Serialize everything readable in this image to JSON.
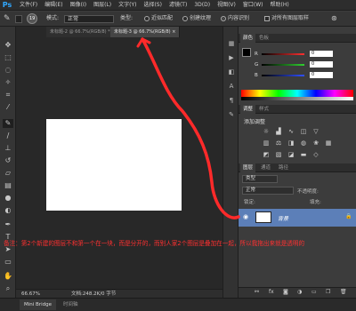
{
  "app": {
    "logo": "Ps"
  },
  "menu": [
    "文件(F)",
    "编辑(E)",
    "图像(I)",
    "图层(L)",
    "文字(Y)",
    "选择(S)",
    "滤镜(T)",
    "3D(D)",
    "视图(V)",
    "窗口(W)",
    "帮助(H)"
  ],
  "options": {
    "size_value": "19",
    "mode_label": "模式:",
    "mode_value": "正常",
    "type_label": "类型:",
    "type_options": [
      {
        "label": "近似匹配",
        "selected": false
      },
      {
        "label": "创建纹理",
        "selected": false
      },
      {
        "label": "内容识别",
        "selected": true
      }
    ],
    "sample_all_label": "对所有图层取样"
  },
  "tabs": [
    {
      "label": "未标题-2 @ 66.7%(RGB/8) *",
      "active": false
    },
    {
      "label": "未标题-3 @ 66.7%(RGB/8)",
      "active": true
    }
  ],
  "status": {
    "zoom": "66.67%",
    "doc_info": "文档:248.2K/0 字节"
  },
  "bottom_tabs": [
    "Mini Bridge",
    "时间轴"
  ],
  "color_panel": {
    "tabs": [
      "颜色",
      "色板"
    ],
    "rows": [
      {
        "label": "R",
        "value": "0",
        "color": "#ff3030"
      },
      {
        "label": "G",
        "value": "0",
        "color": "#30d030"
      },
      {
        "label": "B",
        "value": "0",
        "color": "#3050ff"
      }
    ]
  },
  "adjust_panel": {
    "tabs": [
      "调整",
      "样式"
    ],
    "title": "添加调整",
    "icons": [
      "brightness-icon",
      "levels-icon",
      "curves-icon",
      "exposure-icon",
      "vibrance-icon",
      "hue-icon",
      "balance-icon",
      "bw-icon",
      "photo-filter-icon",
      "mixer-icon",
      "lookup-icon",
      "invert-icon",
      "posterize-icon",
      "threshold-icon",
      "gradient-map-icon",
      "selective-color-icon"
    ]
  },
  "layers_panel": {
    "tabs": [
      "图层",
      "通道",
      "路径"
    ],
    "kind_label": "类型",
    "blend_mode": "正常",
    "opacity_label": "不透明度:",
    "lock_label": "锁定:",
    "fill_label": "填充:",
    "layer_name": "背景"
  },
  "annotation": "备注：第2个新建的图层不和第一个在一块，而是分开的，而别人家2个图层是叠加在一起，所以我拖出来就是透明的"
}
